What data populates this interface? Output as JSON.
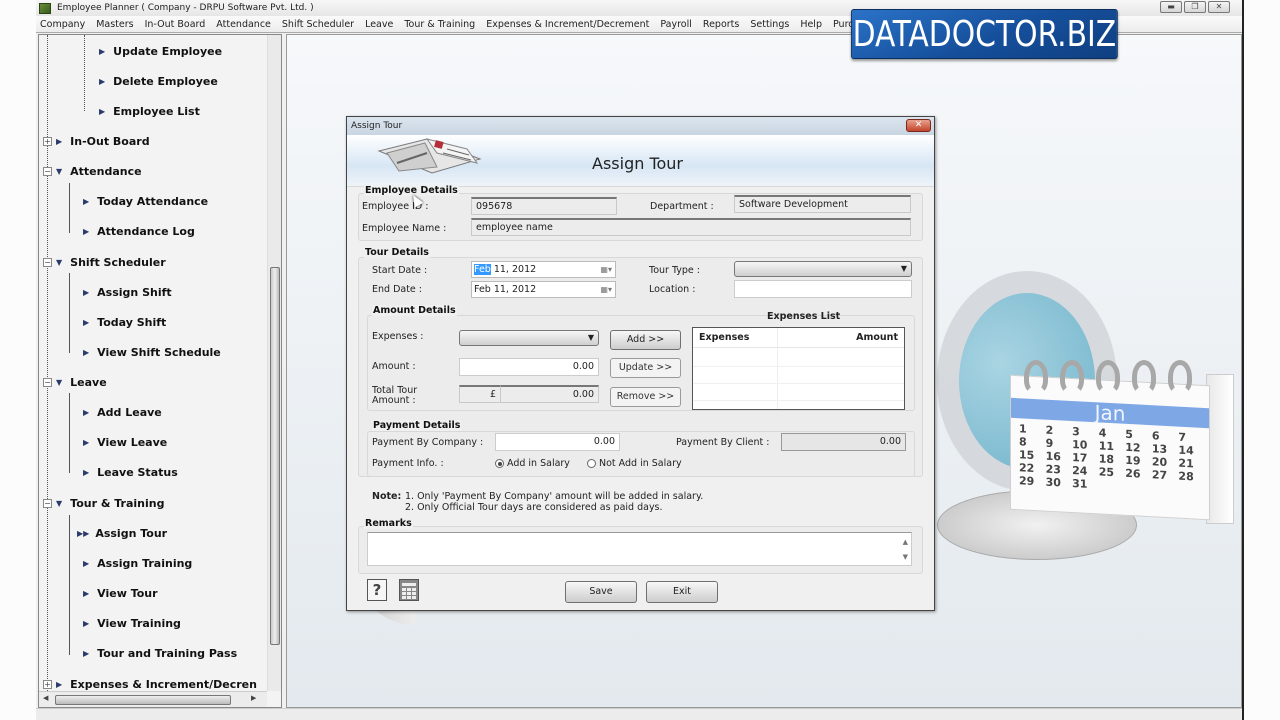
{
  "window": {
    "title": "Employee Planner ( Company - DRPU Software Pvt. Ltd. )",
    "controls": {
      "minimize": "minimize-icon",
      "restore": "restore-icon",
      "close": "close-icon"
    }
  },
  "watermark": "DATADOCTOR.BIZ",
  "menu": [
    "Company",
    "Masters",
    "In-Out Board",
    "Attendance",
    "Shift Scheduler",
    "Leave",
    "Tour & Training",
    "Expenses & Increment/Decrement",
    "Payroll",
    "Reports",
    "Settings",
    "Help",
    "Purchase C"
  ],
  "sidebar": {
    "items": [
      {
        "label": "Update Employee",
        "level": 2
      },
      {
        "label": "Delete Employee",
        "level": 2
      },
      {
        "label": "Employee List",
        "level": 2
      },
      {
        "label": "In-Out Board",
        "level": 1,
        "state": "collapsed"
      },
      {
        "label": "Attendance",
        "level": 1,
        "state": "expanded"
      },
      {
        "label": "Today Attendance",
        "level": 2
      },
      {
        "label": "Attendance Log",
        "level": 2
      },
      {
        "label": "Shift Scheduler",
        "level": 1,
        "state": "expanded"
      },
      {
        "label": "Assign Shift",
        "level": 2
      },
      {
        "label": "Today Shift",
        "level": 2
      },
      {
        "label": "View Shift Schedule",
        "level": 2
      },
      {
        "label": "Leave",
        "level": 1,
        "state": "expanded"
      },
      {
        "label": "Add Leave",
        "level": 2
      },
      {
        "label": "View Leave",
        "level": 2
      },
      {
        "label": "Leave Status",
        "level": 2
      },
      {
        "label": "Tour & Training",
        "level": 1,
        "state": "expanded"
      },
      {
        "label": "Assign Tour",
        "level": 2,
        "selected": true
      },
      {
        "label": "Assign Training",
        "level": 2
      },
      {
        "label": "View Tour",
        "level": 2
      },
      {
        "label": "View Training",
        "level": 2
      },
      {
        "label": "Tour and Training Pass",
        "level": 2
      },
      {
        "label": "Expenses & Increment/Decren",
        "level": 1,
        "state": "collapsed"
      }
    ]
  },
  "background_calendar": {
    "month": "Jan",
    "days": [
      "1",
      "2",
      "3",
      "4",
      "5",
      "6",
      "7",
      "8",
      "9",
      "10",
      "11",
      "12",
      "13",
      "14",
      "15",
      "16",
      "17",
      "18",
      "19",
      "20",
      "21",
      "22",
      "23",
      "24",
      "25",
      "26",
      "27",
      "28",
      "29",
      "30",
      "31"
    ]
  },
  "dialog": {
    "window_title": "Assign Tour",
    "heading": "Assign Tour",
    "employee_details": {
      "legend": "Employee Details",
      "id_label": "Employee ID :",
      "id_value": "095678",
      "department_label": "Department :",
      "department_value": "Software Development",
      "name_label": "Employee Name :",
      "name_value": "employee name"
    },
    "tour_details": {
      "legend": "Tour Details",
      "start_label": "Start Date :",
      "start_month": "Feb",
      "start_rest": " 11, 2012",
      "end_label": "End Date :",
      "end_value": "Feb 11, 2012",
      "type_label": "Tour Type :",
      "type_value": "",
      "location_label": "Location :",
      "location_value": ""
    },
    "amount_details": {
      "legend": "Amount Details",
      "expenses_label": "Expenses :",
      "expenses_value": "",
      "amount_label": "Amount :",
      "amount_value": "0.00",
      "total_label_1": "Total Tour",
      "total_label_2": "Amount :",
      "currency_symbol": "£",
      "total_value": "0.00",
      "add_button": "Add >>",
      "update_button": "Update >>",
      "remove_button": "Remove >>",
      "list_title": "Expenses List",
      "list_columns": [
        "Expenses",
        "Amount"
      ],
      "list_rows": []
    },
    "payment_details": {
      "legend": "Payment Details",
      "company_label": "Payment By Company :",
      "company_value": "0.00",
      "client_label": "Payment By Client :",
      "client_value": "0.00",
      "info_label": "Payment Info. :",
      "options": [
        {
          "label": "Add in Salary",
          "selected": true
        },
        {
          "label": "Not Add in Salary",
          "selected": false
        }
      ]
    },
    "note": {
      "label": "Note:",
      "lines": [
        "1. Only 'Payment By Company' amount will be added in salary.",
        "2. Only Official Tour days are considered as paid days."
      ]
    },
    "remarks": {
      "legend": "Remarks",
      "value": ""
    },
    "buttons": {
      "save": "Save",
      "exit": "Exit",
      "help_icon": "?"
    }
  }
}
